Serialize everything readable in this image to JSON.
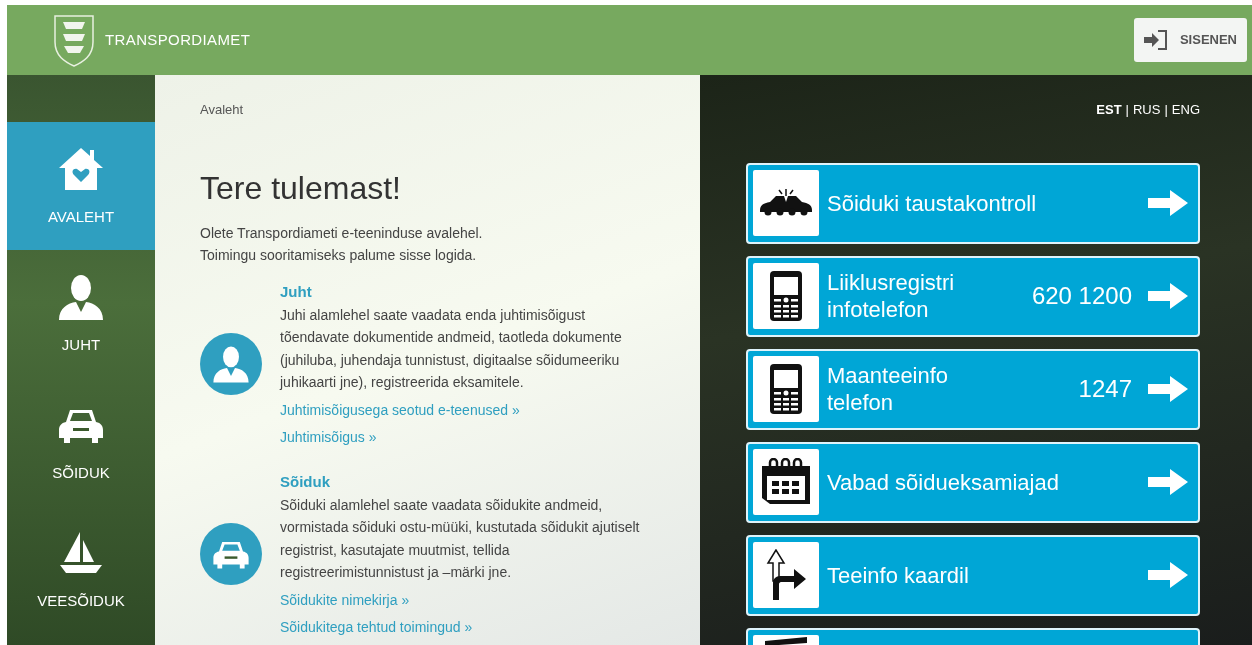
{
  "header": {
    "brand": "TRANSPORDIAMET",
    "login_button": "SISENEN"
  },
  "language_separator": "|",
  "languages": [
    {
      "label": "EST",
      "selected": true
    },
    {
      "label": "RUS",
      "selected": false
    },
    {
      "label": "ENG",
      "selected": false
    }
  ],
  "sidebar": {
    "items": [
      {
        "kind": "home",
        "label": "AVALEHT",
        "selected": true
      },
      {
        "kind": "person",
        "label": "JUHT",
        "selected": false
      },
      {
        "kind": "car",
        "label": "SÕIDUK",
        "selected": false
      },
      {
        "kind": "boat",
        "label": "VEESÕIDUK",
        "selected": false
      }
    ]
  },
  "breadcrumb": "Avaleht",
  "heading": "Tere tulemast!",
  "intro": [
    "Olete Transpordiameti e-teeninduse avalehel.",
    "Toimingu sooritamiseks palume sisse logida."
  ],
  "sections": [
    {
      "kind": "person",
      "title": "Juht",
      "text": "Juhi alamlehel saate vaadata enda juhtimisõigust tõendavate dokumentide andmeid, taotleda dokumente (juhiluba, juhendaja tunnistust, digitaalse sõidumeeriku juhikaarti jne), registreerida eksamitele.",
      "links": [
        "Juhtimisõigusega seotud e-teenused »",
        "Juhtimisõigus »"
      ]
    },
    {
      "kind": "car",
      "title": "Sõiduk",
      "text": "Sõiduki alamlehel saate vaadata sõidukite andmeid, vormistada sõiduki ostu-müüki, kustutada sõidukit ajutiselt registrist, kasutajate muutmist, tellida registreerimistunnistust ja –märki jne.",
      "links": [
        "Sõidukite nimekirja »",
        "Sõidukitega tehtud toimingud »"
      ]
    }
  ],
  "tiles": [
    {
      "kind": "crash",
      "title": [
        "Sõiduki taustakontroll"
      ]
    },
    {
      "kind": "phone",
      "title": [
        "Liiklusregistri",
        "infotelefon"
      ],
      "number": "620 1200"
    },
    {
      "kind": "phone",
      "title": [
        "Maanteeinfo",
        "telefon"
      ],
      "number": "1247"
    },
    {
      "kind": "calendar",
      "title": [
        "Vabad sõidueksamiajad"
      ]
    },
    {
      "kind": "turn",
      "title": [
        "Teeinfo kaardil"
      ]
    },
    {
      "kind": "barrier"
    }
  ]
}
